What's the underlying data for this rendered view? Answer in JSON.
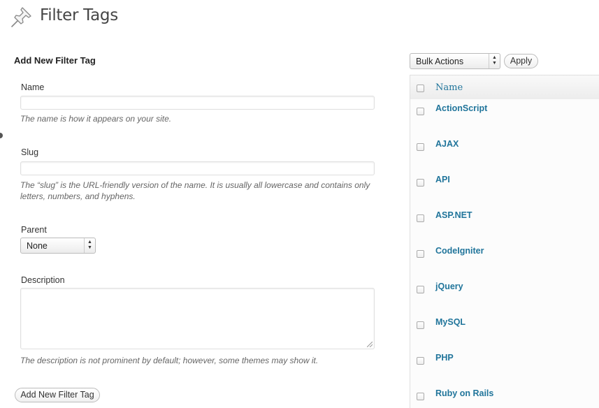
{
  "page": {
    "title": "Filter Tags",
    "icon": "pushpin-icon"
  },
  "form": {
    "heading": "Add New Filter Tag",
    "name": {
      "label": "Name",
      "value": "",
      "hint": "The name is how it appears on your site."
    },
    "slug": {
      "label": "Slug",
      "value": "",
      "hint": "The “slug” is the URL-friendly version of the name. It is usually all lowercase and contains only letters, numbers, and hyphens."
    },
    "parent": {
      "label": "Parent",
      "selected": "None"
    },
    "description": {
      "label": "Description",
      "value": "",
      "hint": "The description is not prominent by default; however, some themes may show it."
    },
    "submit_label": "Add New Filter Tag"
  },
  "list": {
    "bulk_actions": {
      "selected": "Bulk Actions"
    },
    "apply_label": "Apply",
    "column_name": "Name",
    "rows": [
      "ActionScript",
      "AJAX",
      "API",
      "ASP.NET",
      "CodeIgniter",
      "jQuery",
      "MySQL",
      "PHP",
      "Ruby on Rails"
    ]
  },
  "colors": {
    "link": "#21759b",
    "text": "#333333",
    "hint": "#666666"
  }
}
